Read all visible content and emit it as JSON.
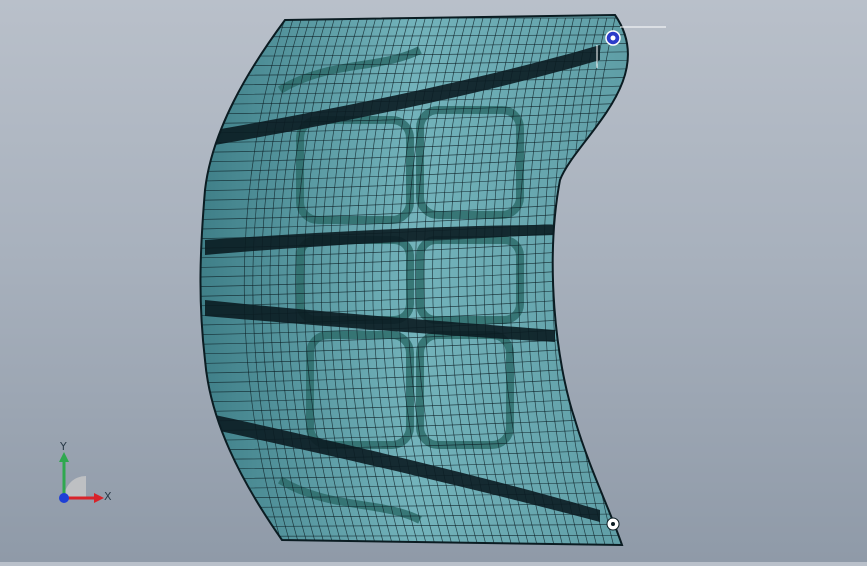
{
  "viewport": {
    "triad": {
      "x_label": "X",
      "y_label": "Y",
      "x_color": "#d8232a",
      "y_color": "#2fa84f",
      "z_color": "#1e3fd6"
    },
    "model": {
      "fill_color": "#5aa0a8",
      "mesh_color": "#0b1c22",
      "pattern_color": "#2e6d6b"
    },
    "markers": {
      "top_marker_color": "#2c3cc9",
      "bottom_marker_color": "#ffffff"
    }
  }
}
